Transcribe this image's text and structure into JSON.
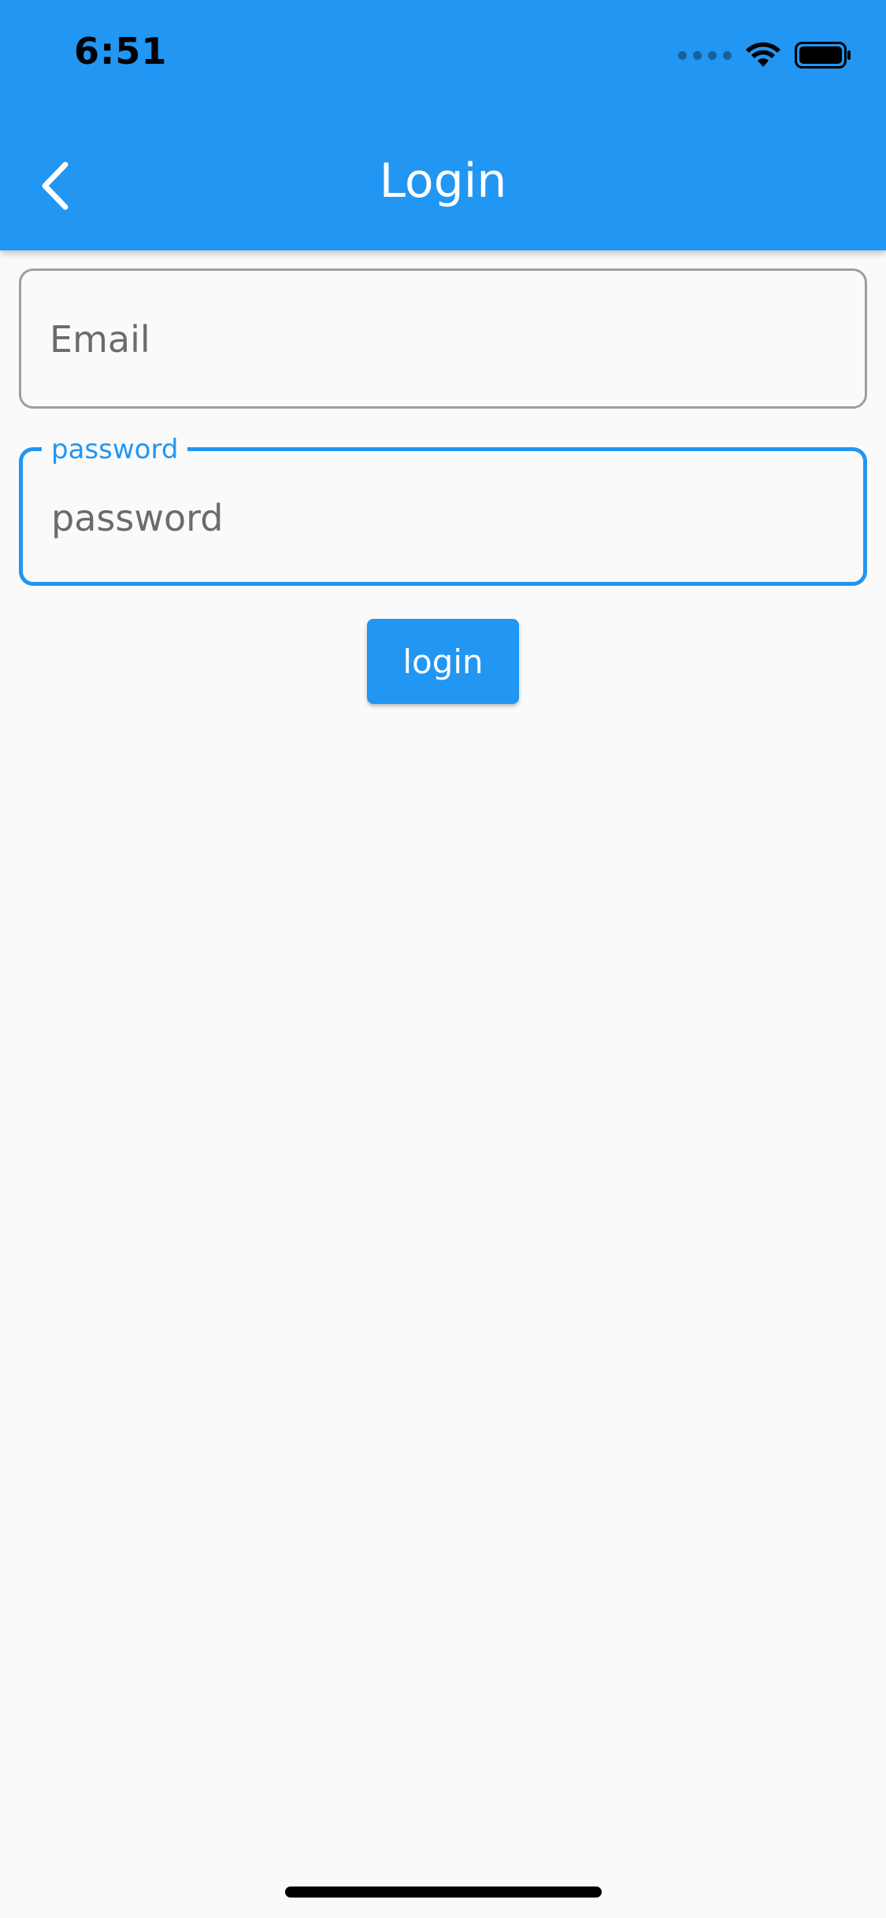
{
  "status_bar": {
    "time": "6:51"
  },
  "app_bar": {
    "title": "Login",
    "back_icon": "chevron-left-icon",
    "background_color": "#2196f3"
  },
  "form": {
    "email": {
      "value": "",
      "placeholder": "Email"
    },
    "password": {
      "label": "password",
      "value": "",
      "placeholder": "password",
      "focused": true
    },
    "submit_label": "login"
  },
  "colors": {
    "accent": "#2196f3",
    "background": "#fafafa",
    "idle_border": "#9e9e9e"
  }
}
